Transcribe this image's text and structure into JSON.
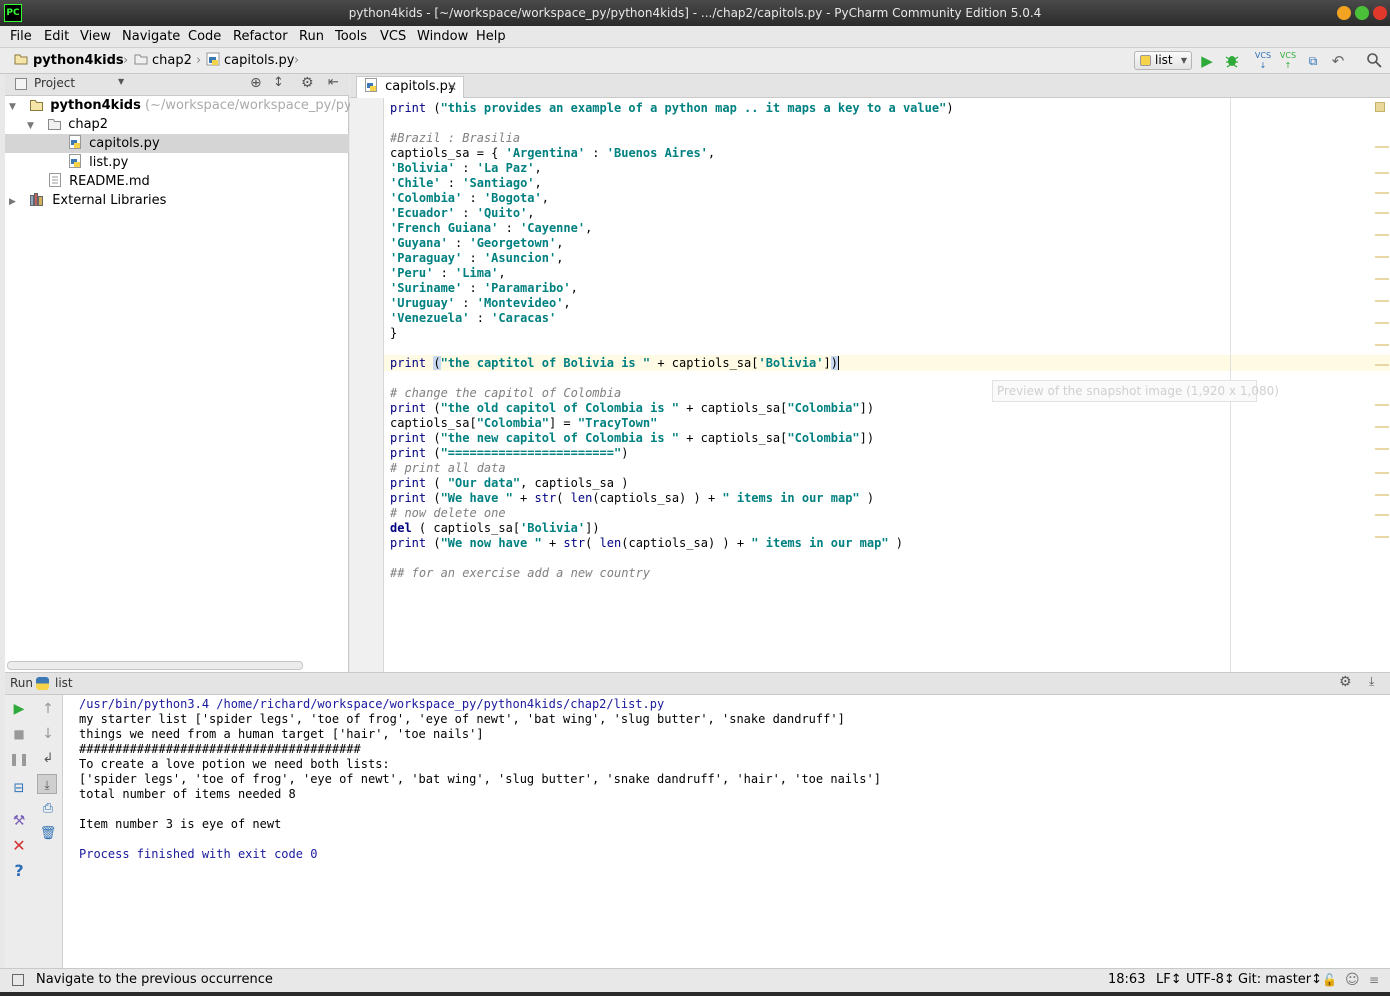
{
  "window": {
    "title": "python4kids - [~/workspace/workspace_py/python4kids] - .../chap2/capitols.py - PyCharm Community Edition 5.0.4",
    "app_icon": "PC"
  },
  "menu": [
    "File",
    "Edit",
    "View",
    "Navigate",
    "Code",
    "Refactor",
    "Run",
    "Tools",
    "VCS",
    "Window",
    "Help"
  ],
  "breadcrumb": [
    "python4kids",
    "chap2",
    "capitols.py"
  ],
  "toolbar": {
    "run_config": "list"
  },
  "project": {
    "header_label": "Project",
    "tree": [
      {
        "label": "python4kids",
        "path": "(~/workspace/workspace_py/pytho"
      },
      {
        "label": "chap2"
      },
      {
        "label": "capitols.py"
      },
      {
        "label": "list.py"
      },
      {
        "label": "README.md"
      },
      {
        "label": "External Libraries"
      }
    ]
  },
  "editor": {
    "tab": "capitols.py",
    "preview_tooltip": "Preview of the snapshot image (1,920 x 1,080)",
    "lines": [
      "print (\"this provides an example of a python map .. it maps a key to a value\")",
      "",
      "#Brazil : Brasilia",
      "captiols_sa = { 'Argentina' : 'Buenos Aires',",
      "'Bolivia' : 'La Paz',",
      "'Chile' : 'Santiago',",
      "'Colombia' : 'Bogota',",
      "'Ecuador' : 'Quito',",
      "'French Guiana' : 'Cayenne',",
      "'Guyana' : 'Georgetown',",
      "'Paraguay' : 'Asuncion',",
      "'Peru' : 'Lima',",
      "'Suriname' : 'Paramaribo',",
      "'Uruguay' : 'Montevideo',",
      "'Venezuela' : 'Caracas'",
      "}",
      "",
      "print (\"the captitol of Bolivia is \" + captiols_sa['Bolivia'])",
      "",
      "# change the capitol of Colombia",
      "print (\"the old capitol of Colombia is \" + captiols_sa[\"Colombia\"])",
      "captiols_sa[\"Colombia\"] = \"TracyTown\"",
      "print (\"the new capitol of Colombia is \" + captiols_sa[\"Colombia\"])",
      "print (\"=======================\")",
      "# print all data",
      "print ( \"Our data\", captiols_sa )",
      "print (\"We have \" + str( len(captiols_sa) ) + \" items in our map\" )",
      "# now delete one",
      "del ( captiols_sa['Bolivia'])",
      "print (\"We now have \" + str( len(captiols_sa) ) + \" items in our map\" )",
      "",
      "## for an exercise add a new country"
    ]
  },
  "run": {
    "label": "Run",
    "config": "list",
    "output": [
      "/usr/bin/python3.4 /home/richard/workspace/workspace_py/python4kids/chap2/list.py",
      "my starter list ['spider legs', 'toe of frog', 'eye of newt', 'bat wing', 'slug butter', 'snake dandruff']",
      "things we need from a human target ['hair', 'toe nails']",
      "#######################################",
      "To create a love potion we need both lists:",
      "['spider legs', 'toe of frog', 'eye of newt', 'bat wing', 'slug butter', 'snake dandruff', 'hair', 'toe nails']",
      "total number of items needed 8",
      "",
      "Item number 3 is eye of newt",
      "",
      "Process finished with exit code 0"
    ]
  },
  "status": {
    "message": "Navigate to the previous occurrence",
    "position": "18:63",
    "line_sep": "LF↕",
    "encoding": "UTF-8↕",
    "git": "Git: master↕"
  },
  "colors": {
    "keyword": "#000080",
    "string": "#008080",
    "comment": "#808080",
    "run_green": "#2eaa3a",
    "stop_red": "#d43030",
    "link_blue": "#1a1a9e"
  }
}
